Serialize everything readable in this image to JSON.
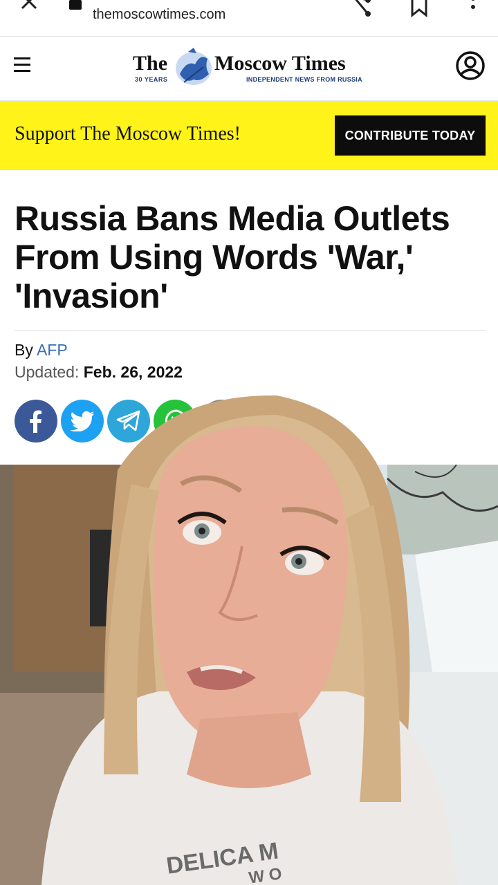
{
  "browser": {
    "url": "themoscowtimes.com"
  },
  "header": {
    "logo_the": "The",
    "logo_name": "Moscow Times",
    "logo_years": "30 YEARS",
    "logo_tagline": "INDEPENDENT NEWS FROM RUSSIA"
  },
  "support": {
    "message": "Support The Moscow Times!",
    "button_label": "CONTRIBUTE TODAY"
  },
  "article": {
    "headline": "Russia Bans Media Outlets From Using Words 'War,' 'Invasion'",
    "by_label": "By",
    "author": "AFP",
    "updated_label": "Updated:",
    "updated_date": "Feb. 26, 2022"
  },
  "shirt_text_line1": "DELICA M",
  "shirt_text_line2": "W O",
  "social": [
    "facebook-icon",
    "twitter-icon",
    "telegram-icon",
    "whatsapp-icon",
    "email-icon"
  ],
  "colors": {
    "banner": "#fff31a",
    "button": "#0d0d0d",
    "author_link": "#3b6fb5",
    "facebook": "#3b5998",
    "twitter": "#1da1f2",
    "telegram": "#2ea6da",
    "whatsapp": "#25c23a"
  }
}
